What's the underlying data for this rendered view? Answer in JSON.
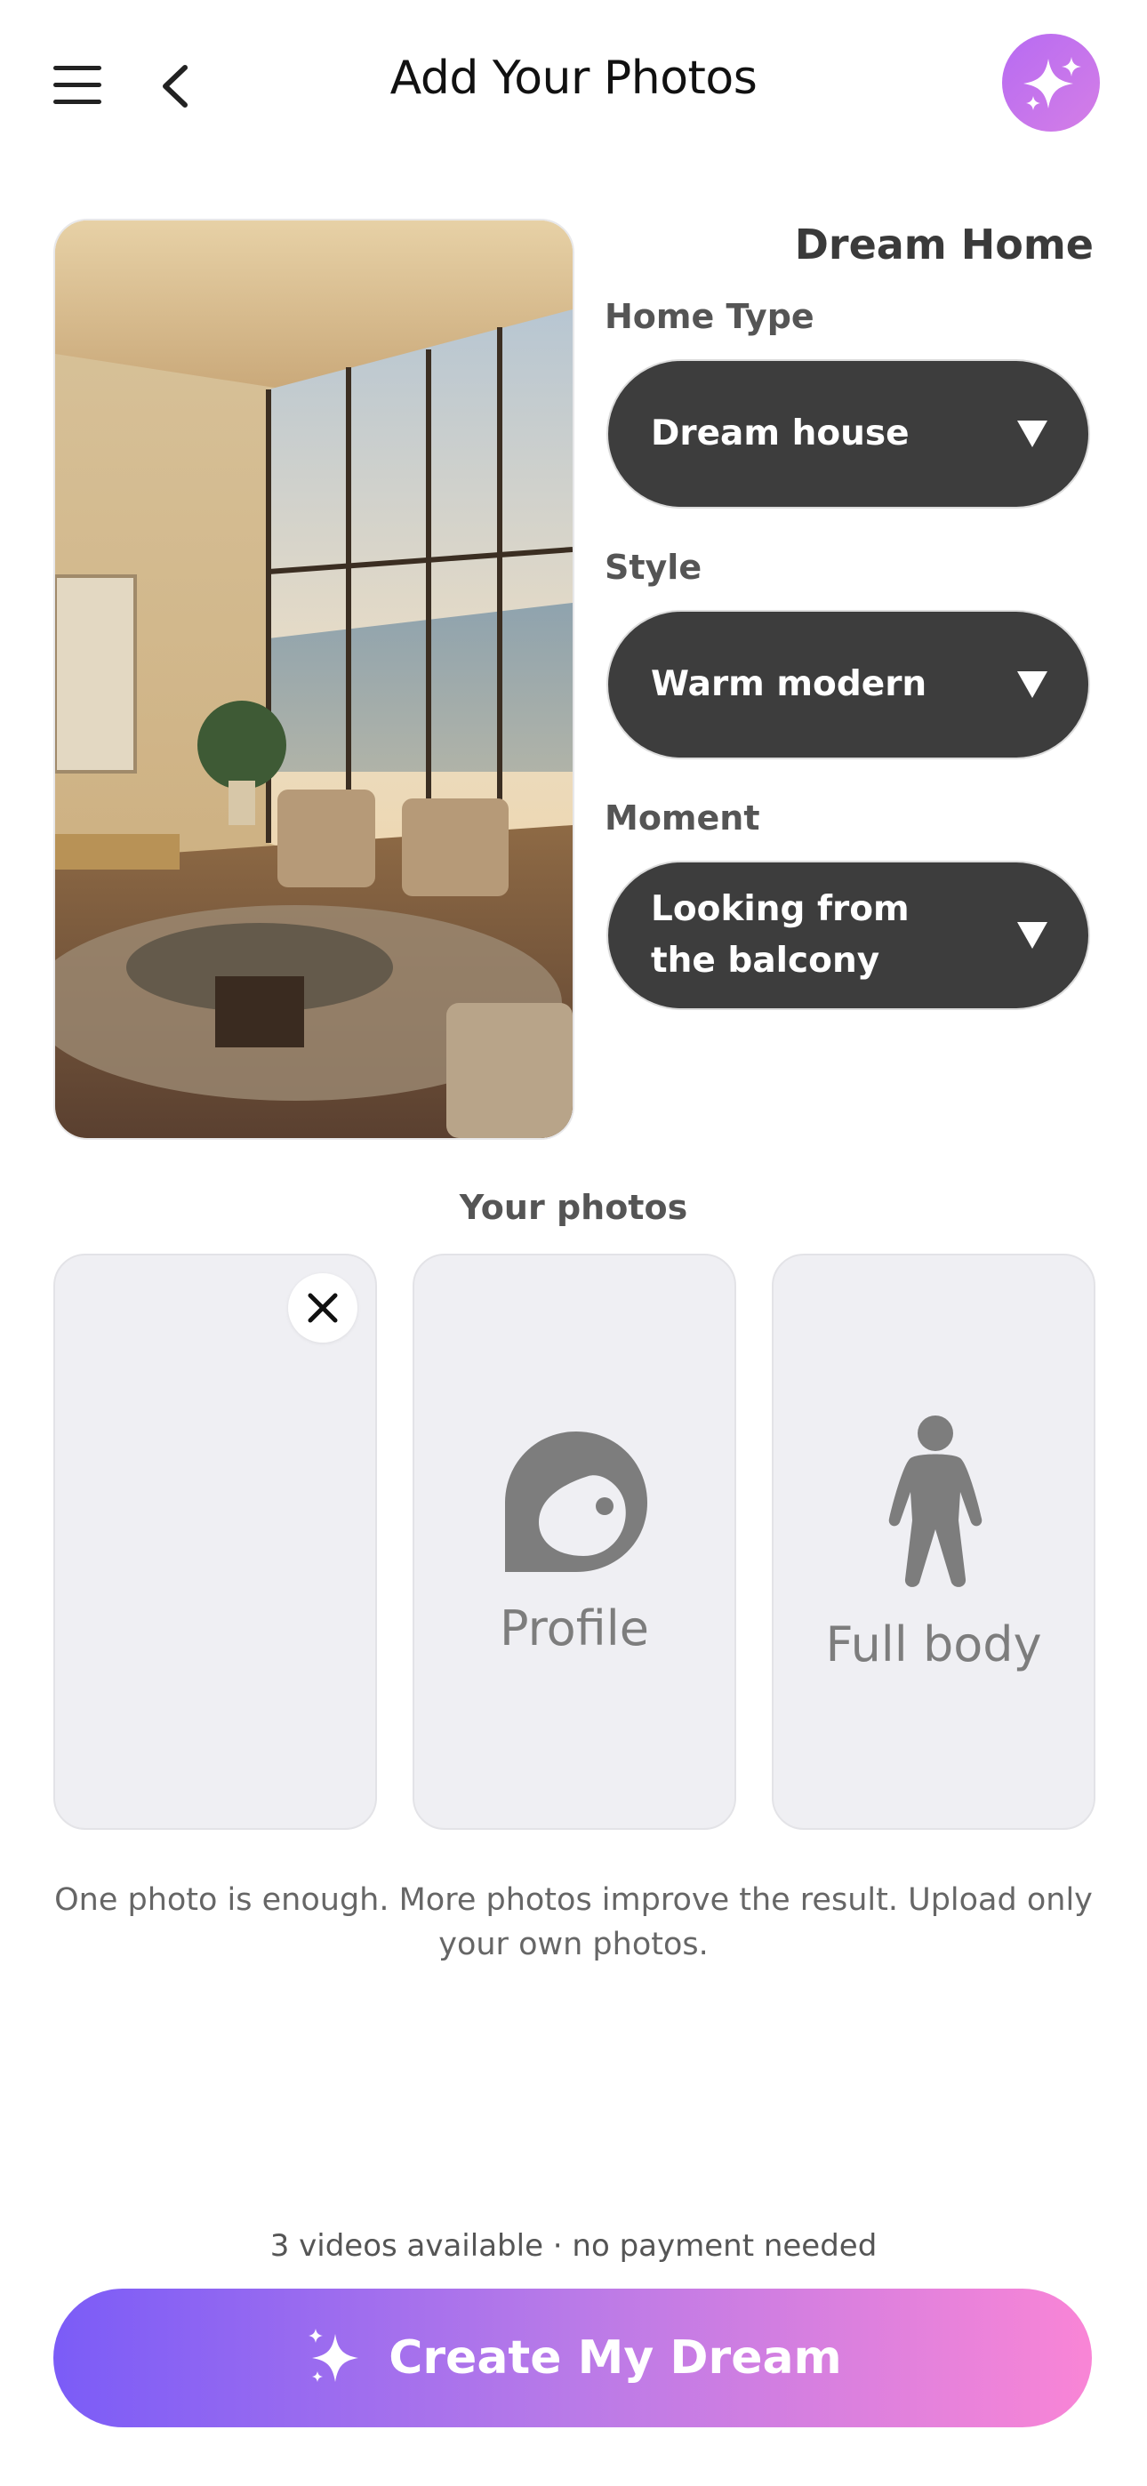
{
  "header": {
    "title": "Add Your Photos",
    "menu_icon": "hamburger-menu-icon",
    "back_icon": "chevron-left-icon",
    "action_icon": "sparkles-icon"
  },
  "card": {
    "title": "Dream Home",
    "image_icon": "luxury-living-room-ocean-view",
    "fields": [
      {
        "label": "Home Type",
        "value": "Dream house"
      },
      {
        "label": "Style",
        "value": "Warm modern"
      },
      {
        "label": "Moment",
        "value": "Looking from the balcony"
      }
    ]
  },
  "photos": {
    "title": "Your photos",
    "slots": [
      {
        "caption": "",
        "icon": "close-icon"
      },
      {
        "caption": "Profile",
        "icon": "face-profile-icon"
      },
      {
        "caption": "Full body",
        "icon": "person-full-body-icon"
      }
    ],
    "hint": "One photo is enough. More photos improve the result. Upload only your own photos."
  },
  "footer": {
    "availability": "3 videos available · no payment needed",
    "cta_label": "Create My Dream"
  },
  "colors": {
    "select_bg": "#3d3d3d",
    "accent_start": "#7b5cf7",
    "accent_end": "#f985d6",
    "slot_bg": "#efeff3"
  }
}
